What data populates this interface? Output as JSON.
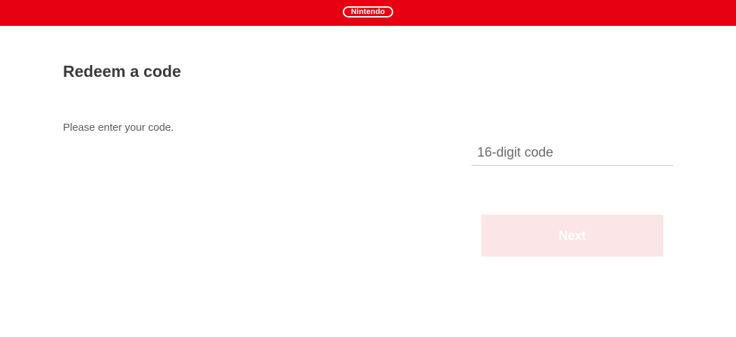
{
  "header": {
    "logo_text": "Nintendo",
    "brand_color": "#e60012"
  },
  "main": {
    "title": "Redeem a code",
    "instruction": "Please enter your code.",
    "code_input": {
      "value": "",
      "placeholder": "16-digit code"
    },
    "next_button_label": "Next",
    "next_button_state": "disabled"
  }
}
